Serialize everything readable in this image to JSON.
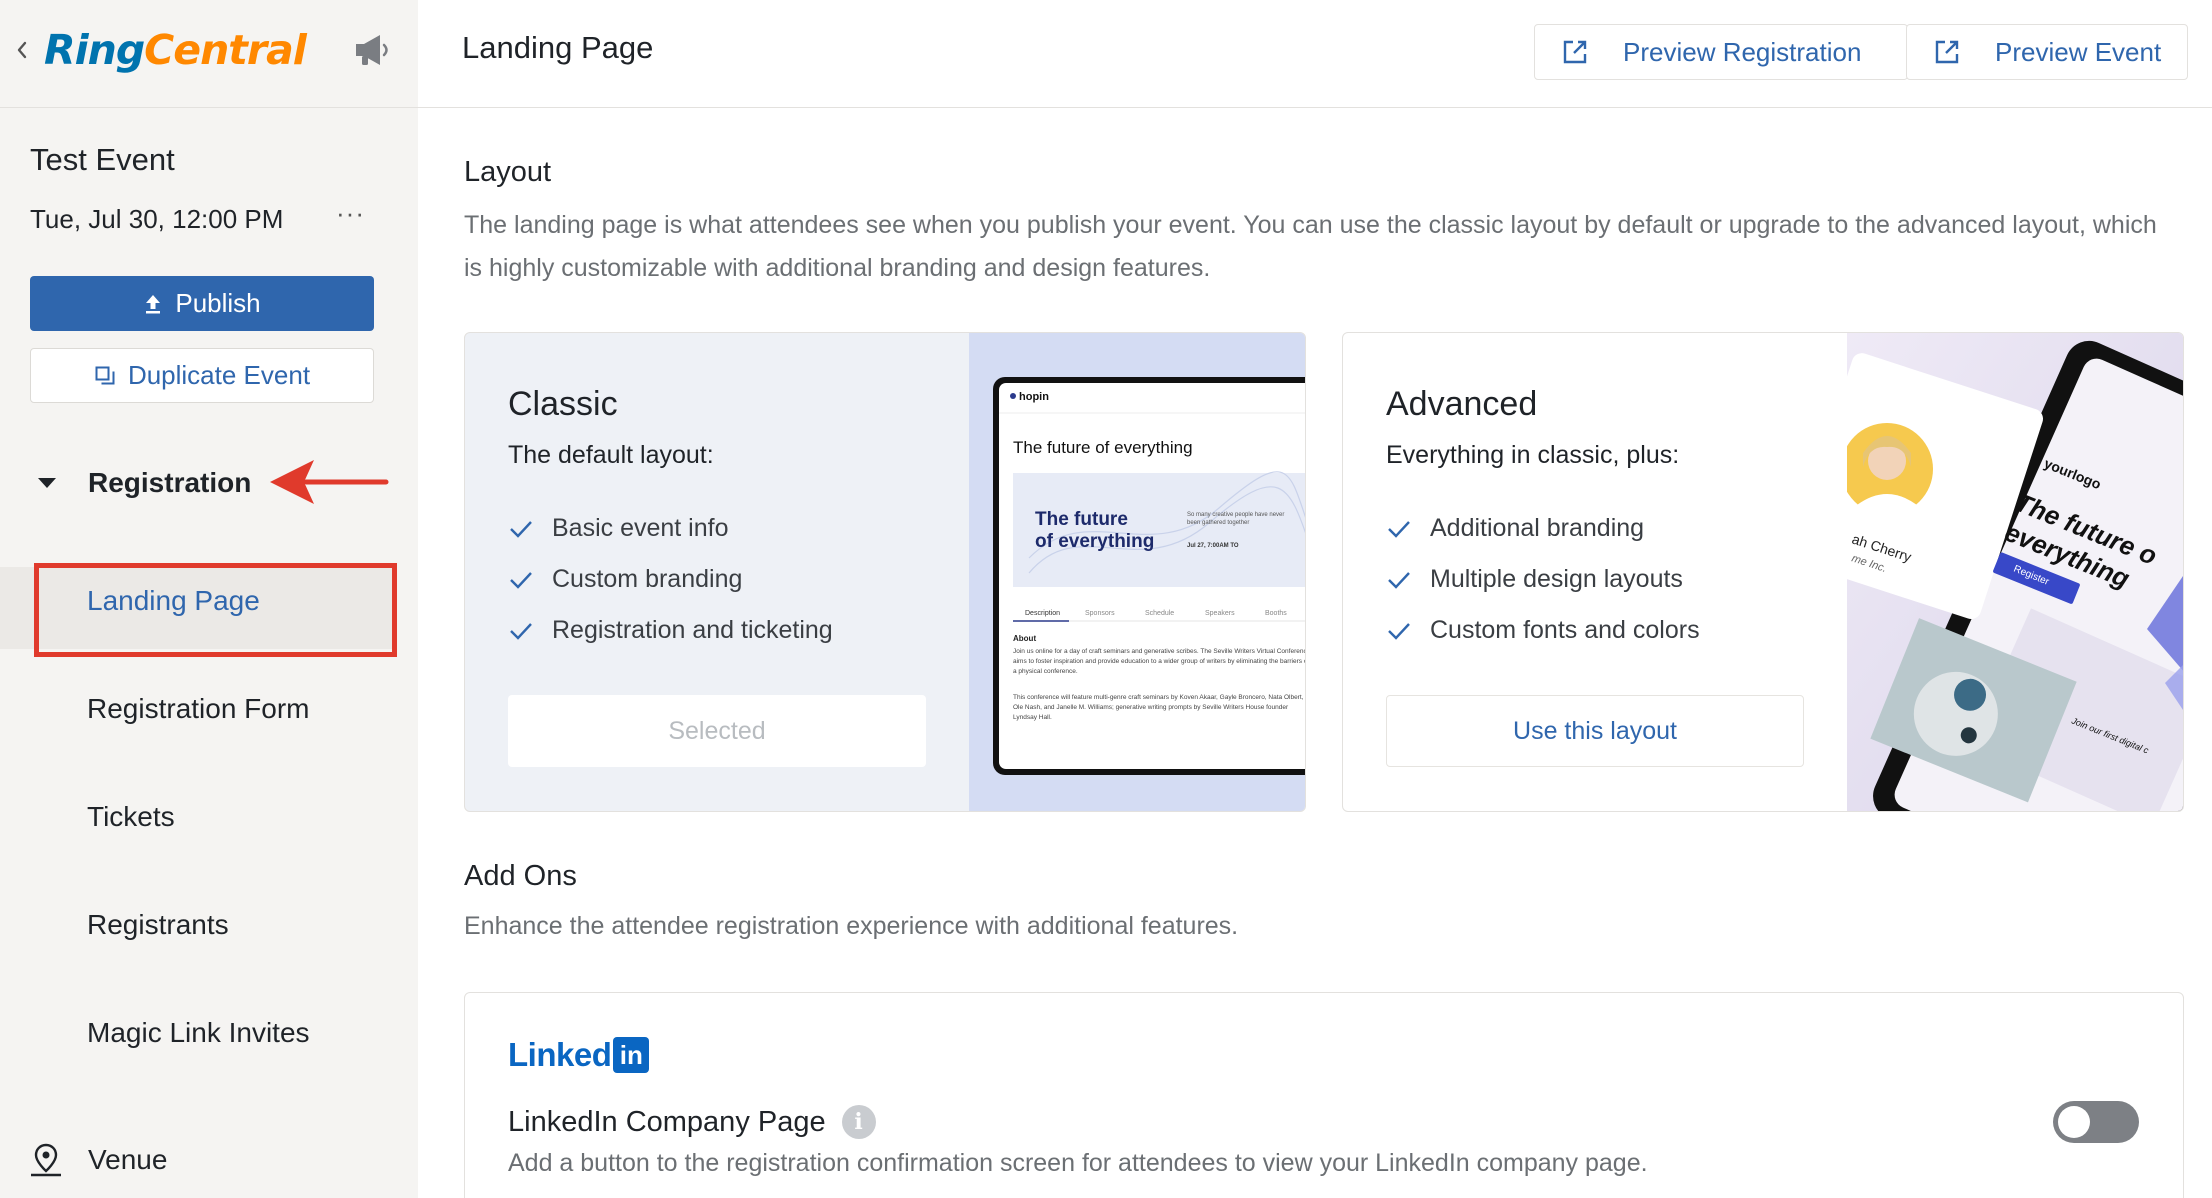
{
  "sidebar": {
    "logo": {
      "ring": "Ring",
      "central": "Central"
    },
    "event_title": "Test Event",
    "event_date": "Tue, Jul 30, 12:00 PM",
    "more_label": "···",
    "publish_label": "Publish",
    "duplicate_label": "Duplicate Event",
    "section_label": "Registration",
    "items": [
      {
        "label": "Landing Page",
        "active": true
      },
      {
        "label": "Registration Form"
      },
      {
        "label": "Tickets"
      },
      {
        "label": "Registrants"
      },
      {
        "label": "Magic Link Invites"
      }
    ],
    "venue_label": "Venue"
  },
  "header": {
    "title": "Landing Page",
    "preview_registration": "Preview Registration",
    "preview_event": "Preview Event"
  },
  "layout": {
    "heading": "Layout",
    "description": "The landing page is what attendees see when you publish your event. You can use the classic layout by default or upgrade to the advanced layout, which is highly customizable with additional branding and design features.",
    "classic": {
      "title": "Classic",
      "subtitle": "The default layout:",
      "features": [
        "Basic event info",
        "Custom branding",
        "Registration and ticketing"
      ],
      "button": "Selected",
      "preview": {
        "brand": "hopin",
        "headline": "The future of everything",
        "hero_line1": "The future",
        "hero_line2": "of everything",
        "hero_note": "So many creative people have never been gathered together",
        "hero_date": "Jul 27, 7:00AM TO",
        "tabs": [
          "Description",
          "Sponsors",
          "Schedule",
          "Speakers",
          "Booths"
        ],
        "about_label": "About",
        "about_text1": "Join us online for a day of craft seminars and generative scribes. The Seville Writers Virtual Conference aims to foster inspiration and provide education to a wider group of writers by eliminating the barriers of a physical conference.",
        "about_text2": "This conference will feature multi-genre craft seminars by Koven Akaar, Gayle Broncero, Nata Olbert, Ole Nash, and Janelle M. Williams; generative writing prompts by Seville Writers House founder Lyndsay Hall."
      }
    },
    "advanced": {
      "title": "Advanced",
      "subtitle": "Everything in classic, plus:",
      "features": [
        "Additional branding",
        "Multiple design layouts",
        "Custom fonts and colors"
      ],
      "button": "Use this layout",
      "preview": {
        "logo": "yourlogo",
        "headline1": "The future o",
        "headline2": "everything",
        "register": "Register",
        "name": "ah Cherry",
        "company": "me Inc.",
        "join": "Join our first digital c"
      }
    }
  },
  "addons": {
    "heading": "Add Ons",
    "description": "Enhance the attendee registration experience with additional features.",
    "linkedin": {
      "logo_text": "Linked",
      "logo_box": "in",
      "title": "LinkedIn Company Page",
      "info": "i",
      "description": "Add a button to the registration confirmation screen for attendees to view your LinkedIn company page.",
      "enabled": false
    }
  },
  "colors": {
    "accent": "#2f66ad",
    "highlight": "#e03a2c",
    "linkedin": "#0a66c2"
  }
}
